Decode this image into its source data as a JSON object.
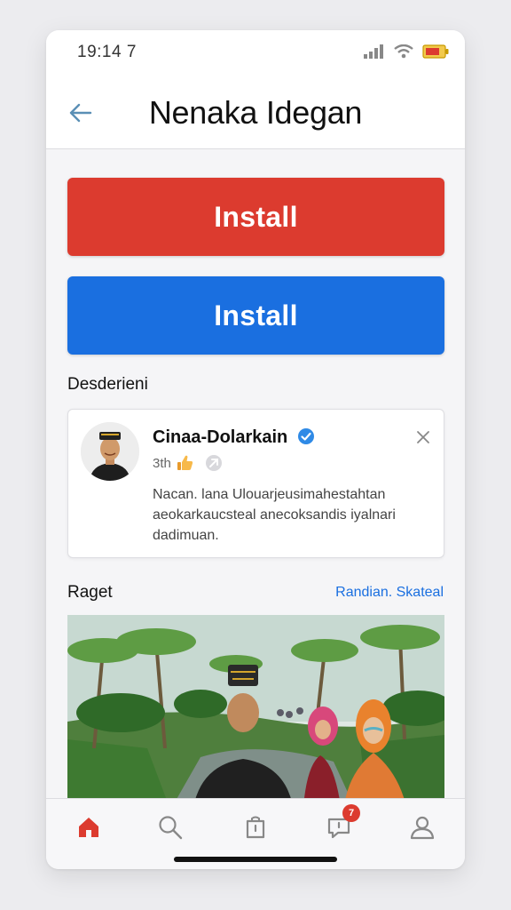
{
  "status_bar": {
    "time": "19:14 7"
  },
  "header": {
    "title": "Nenaka Idegan"
  },
  "buttons": {
    "install_primary": "Install",
    "install_secondary": "Install"
  },
  "description_section": {
    "title": "Desderieni"
  },
  "card": {
    "name": "Cinaa-Dolarkain",
    "meta": "3th",
    "description": "Nacan. lana Ulouarjeusimahestahtan aeokarkaucsteal anecoksandis iyalnari dadimuan."
  },
  "related": {
    "title": "Raget",
    "link": "Randian. Skateal"
  },
  "tabbar": {
    "messages_badge": "7"
  },
  "colors": {
    "primary_red": "#dc3b2f",
    "primary_blue": "#1a6fe0",
    "verified": "#2f8ae6",
    "link": "#1a6fe0"
  },
  "icons": [
    "back-arrow-icon",
    "signal-icon",
    "wifi-icon",
    "battery-icon",
    "verified-icon",
    "close-icon",
    "thumbs-up-icon",
    "pin-icon",
    "home-icon",
    "search-icon",
    "shopping-icon",
    "messages-icon",
    "profile-icon"
  ]
}
